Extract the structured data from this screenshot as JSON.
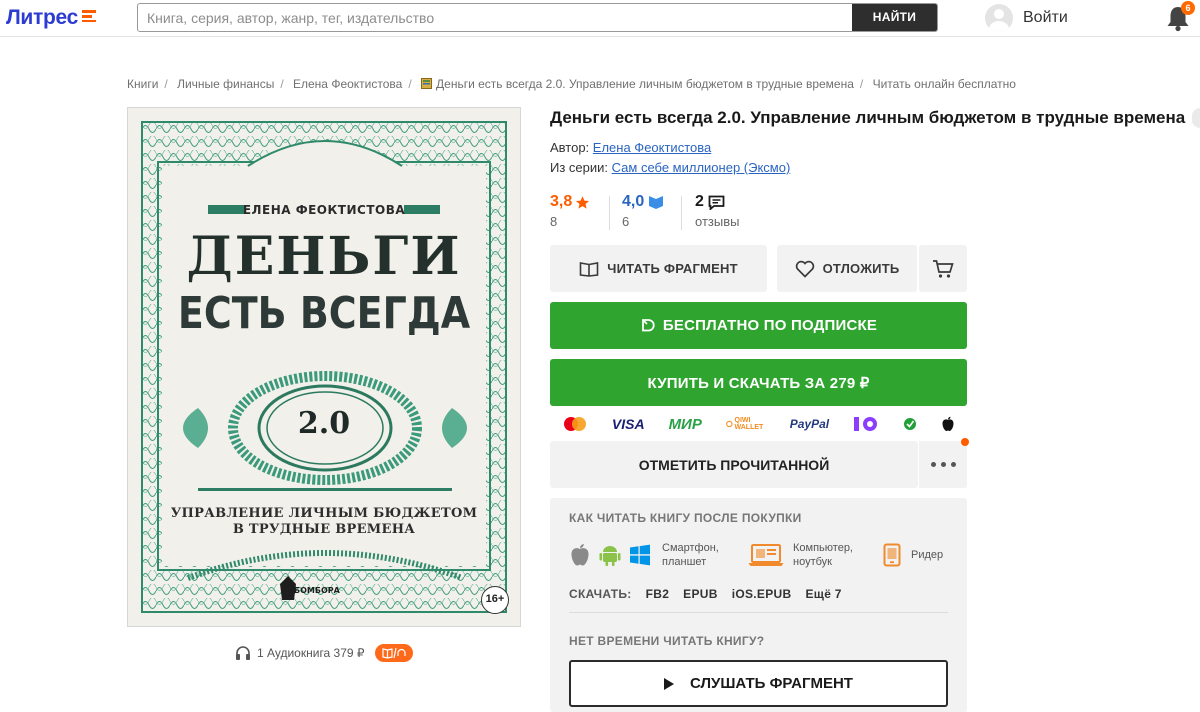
{
  "header": {
    "logo": "Литрес",
    "search_placeholder": "Книга, серия, автор, жанр, тег, издательство",
    "search_button": "НАЙТИ",
    "login_label": "Войти",
    "notifications_count": "6"
  },
  "breadcrumb": [
    "Книги",
    "Личные финансы",
    "Елена Феоктистова",
    "Деньги есть всегда 2.0. Управление личным бюджетом в трудные времена",
    "Читать онлайн бесплатно"
  ],
  "cover": {
    "author": "ЕЛЕНА ФЕОКТИСТОВА",
    "title_line1": "ДЕНЬГИ",
    "title_line2": "ЕСТЬ ВСЕГДА",
    "version": "2.0",
    "subtitle_line1": "УПРАВЛЕНИЕ ЛИЧНЫМ БЮДЖЕТОМ",
    "subtitle_line2": "В ТРУДНЫЕ ВРЕМЕНА",
    "publisher": "БОМБОРА",
    "age": "16+"
  },
  "audio": {
    "label": "1 Аудиокнига 379 ₽"
  },
  "book": {
    "title": "Деньги есть всегда 2.0. Управление личным бюджетом в трудные времена",
    "author_label": "Автор:",
    "author": "Елена Феоктистова",
    "series_label": "Из серии:",
    "series": "Сам себе миллионер (Эксмо)"
  },
  "ratings": {
    "litres_rating": "3,8",
    "litres_count": "8",
    "livelib_rating": "4,0",
    "livelib_count": "6",
    "reviews_count": "2",
    "reviews_label": "отзывы"
  },
  "actions": {
    "read_fragment": "ЧИТАТЬ ФРАГМЕНТ",
    "postpone": "ОТЛОЖИТЬ",
    "subscription": "БЕСПЛАТНО ПО ПОДПИСКЕ",
    "buy": "КУПИТЬ И СКАЧАТЬ ЗА 279 ₽",
    "mark_read": "ОТМЕТИТЬ ПРОЧИТАННОЙ"
  },
  "payments": [
    "mastercard",
    "VISA",
    "МИР",
    "QIWI WALLET",
    "PayPal",
    "ЮMoney",
    "sber",
    "apple"
  ],
  "how_to_read": {
    "title": "КАК ЧИТАТЬ КНИГУ ПОСЛЕ ПОКУПКИ",
    "phone_line1": "Смартфон,",
    "phone_line2": "планшет",
    "computer_line1": "Компьютер,",
    "computer_line2": "ноутбук",
    "reader": "Ридер",
    "download_label": "СКАЧАТЬ:",
    "formats": [
      "FB2",
      "EPUB",
      "iOS.EPUB",
      "Ещё 7"
    ]
  },
  "listen": {
    "title": "НЕТ ВРЕМЕНИ ЧИТАТЬ КНИГУ?",
    "button": "СЛУШАТЬ ФРАГМЕНТ"
  },
  "colors": {
    "brand_blue": "#2c3bd1",
    "accent_orange": "#ff5c00",
    "green": "#2fa42f",
    "link": "#2a64c2"
  }
}
